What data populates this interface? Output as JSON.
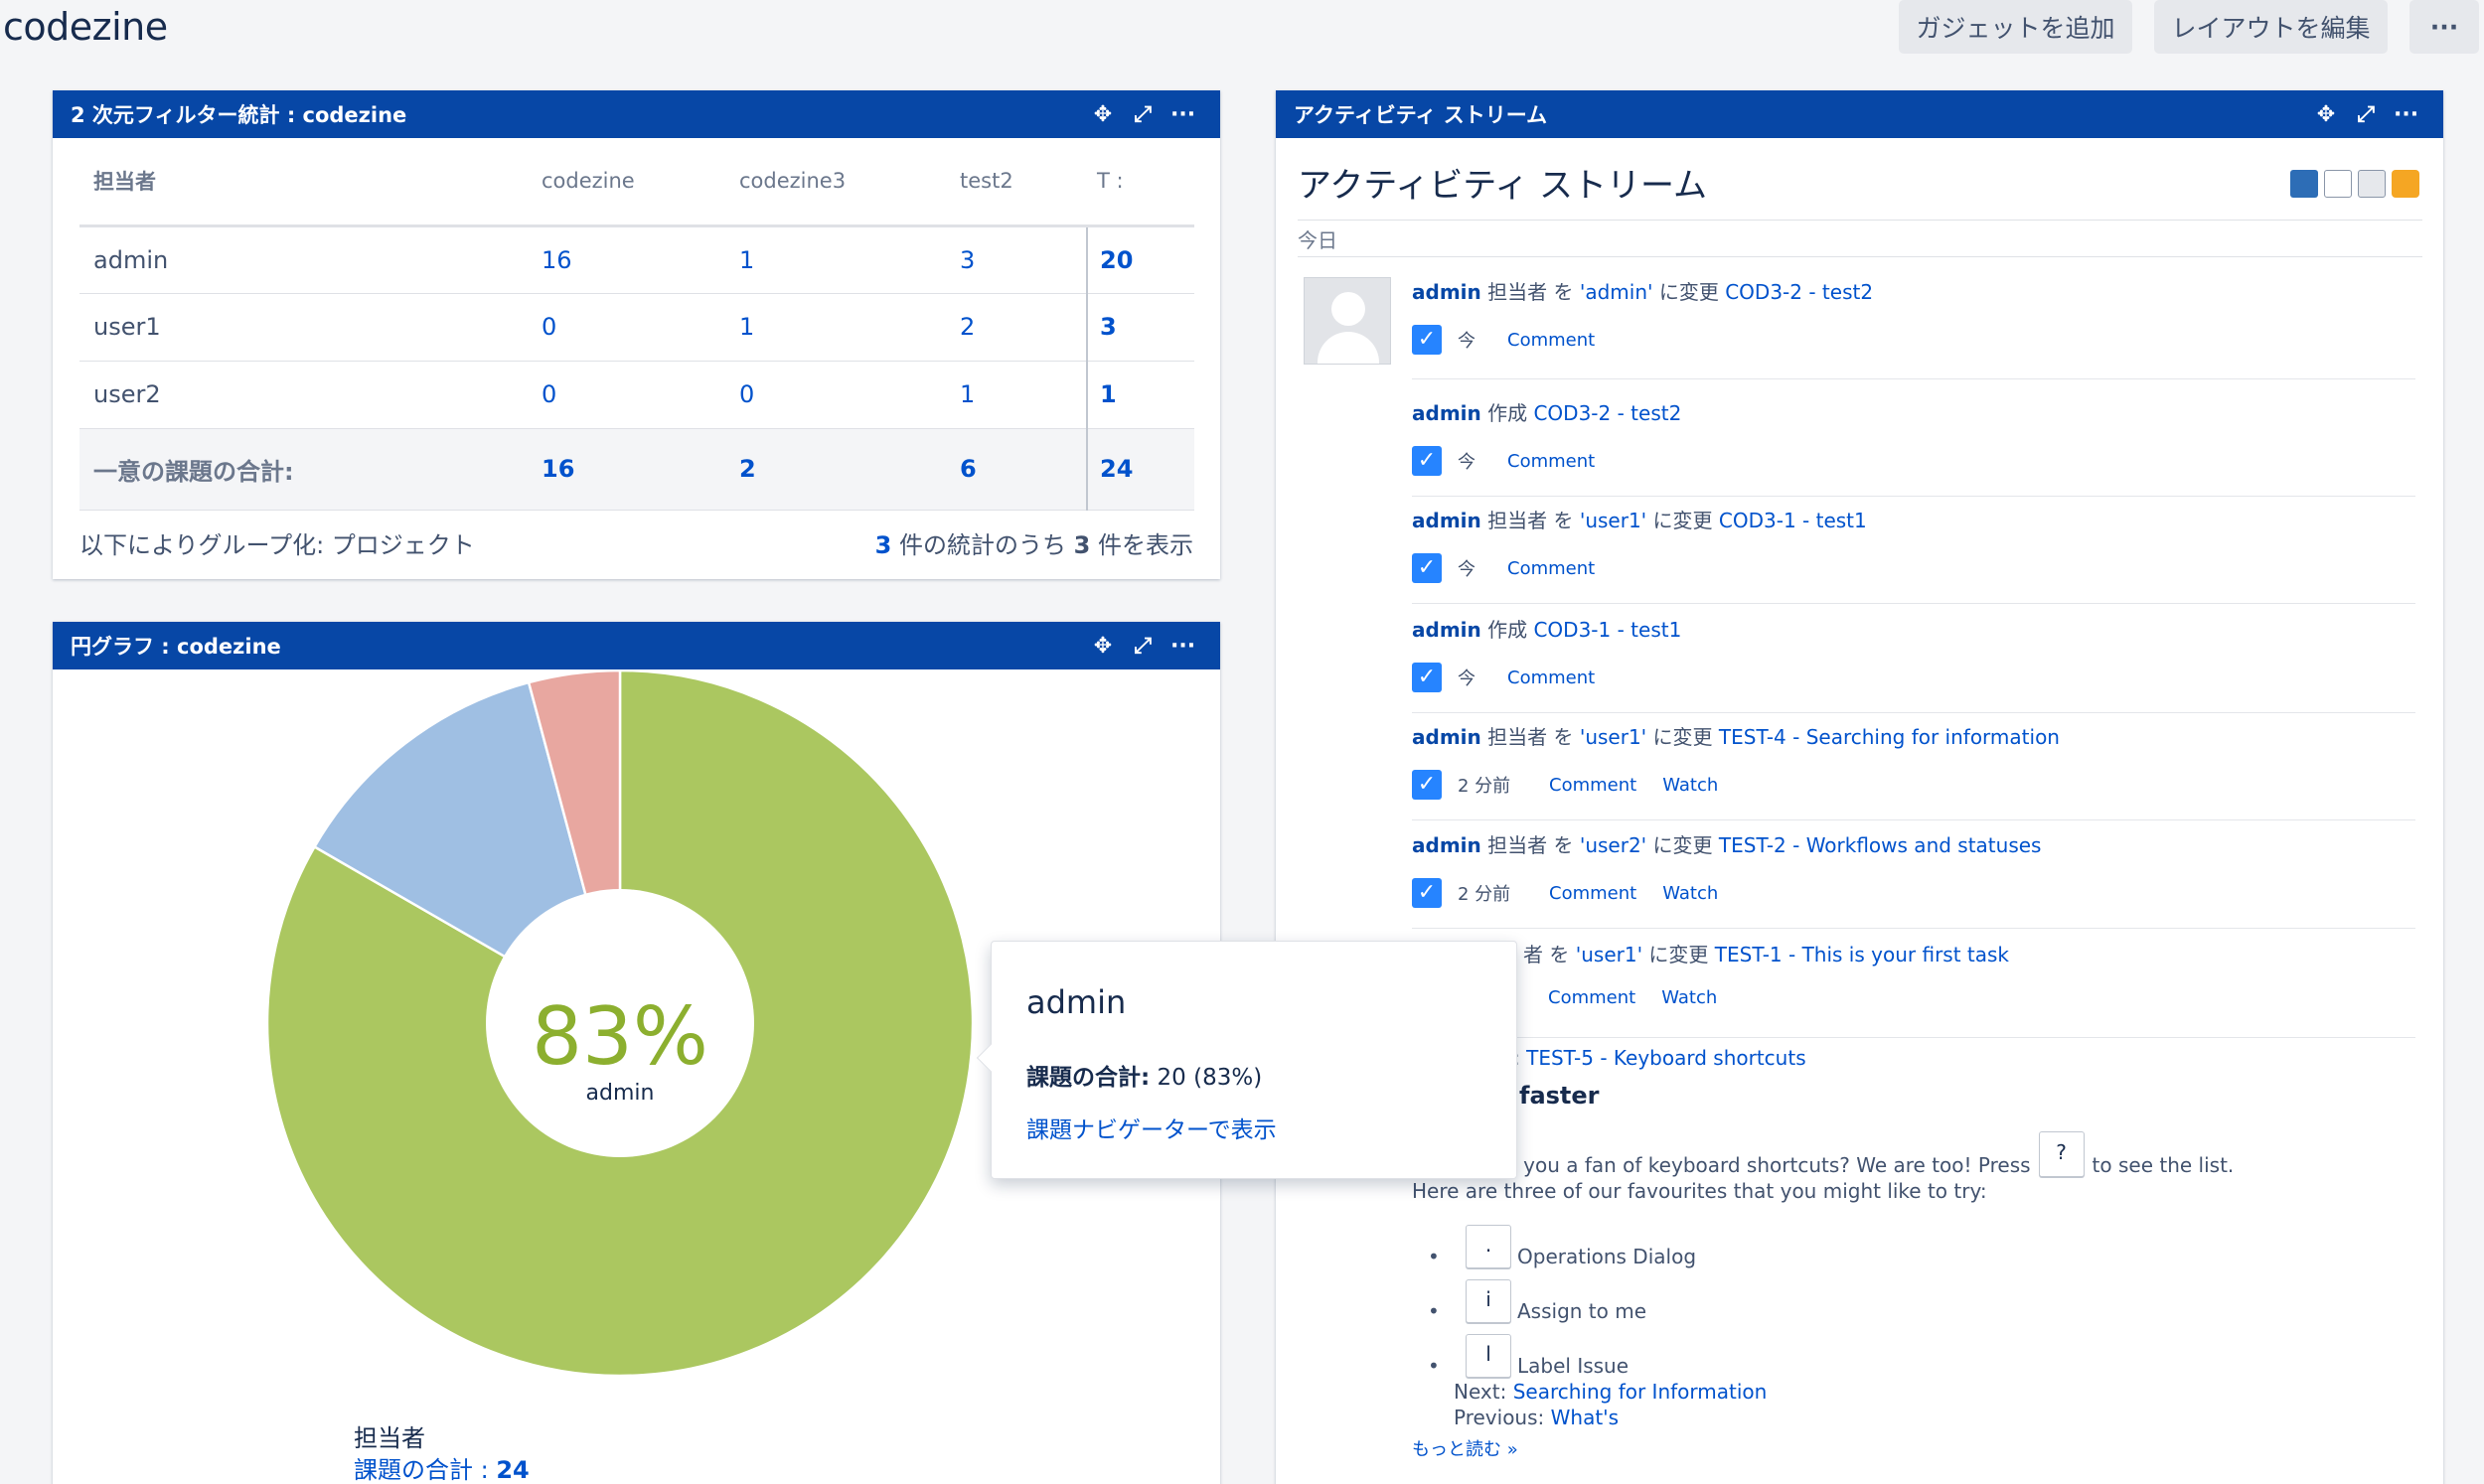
{
  "dashboard": {
    "title": "codezine",
    "add_gadget": "ガジェットを追加",
    "edit_layout": "レイアウトを編集",
    "more": "···"
  },
  "icons": {
    "move": "move-icon",
    "expand": "expand-icon",
    "menu": "more-icon"
  },
  "two_d": {
    "title": "2 次元フィルター統計 : codezine",
    "headers": [
      "担当者",
      "codezine",
      "codezine3",
      "test2",
      "T :"
    ],
    "rows": [
      {
        "name": "admin",
        "values": [
          "16",
          "1",
          "3"
        ],
        "total": "20"
      },
      {
        "name": "user1",
        "values": [
          "0",
          "1",
          "2"
        ],
        "total": "3"
      },
      {
        "name": "user2",
        "values": [
          "0",
          "0",
          "1"
        ],
        "total": "1"
      }
    ],
    "sum": {
      "label": "一意の課題の合計:",
      "values": [
        "16",
        "2",
        "6"
      ],
      "total": "24"
    },
    "group_by": "以下によりグループ化: プロジェクト",
    "count_shown": "3",
    "count_mid": "件の統計のうち",
    "count_total": "3",
    "count_end": "件を表示"
  },
  "pie": {
    "title": "円グラフ : codezine",
    "center_pct": "83%",
    "center_label": "admin",
    "legend_title": "担当者",
    "legend_total_label": "課題の合計 :",
    "legend_total": "24",
    "tooltip": {
      "name": "admin",
      "label": "課題の合計:",
      "value": "20 (83%)",
      "link": "課題ナビゲーターで表示"
    }
  },
  "chart_data": {
    "type": "pie",
    "categories": [
      "admin",
      "user1",
      "user2"
    ],
    "values": [
      20,
      3,
      1
    ],
    "colors": [
      "#abc760",
      "#9fbfe3",
      "#e8a7a0"
    ],
    "total": 24
  },
  "activity": {
    "header": "アクティビティ ストリーム",
    "title": "アクティビティ ストリーム",
    "today": "今日",
    "entries": [
      {
        "user": "admin",
        "verb": "担当者 を",
        "target": "'admin'",
        "verb2": "に変更",
        "issue": "COD3-2 - test2",
        "time": "今",
        "actions": [
          "Comment"
        ]
      },
      {
        "user": "admin",
        "verb": "作成",
        "target": "",
        "verb2": "",
        "issue": "COD3-2 - test2",
        "time": "今",
        "actions": [
          "Comment"
        ]
      },
      {
        "user": "admin",
        "verb": "担当者 を",
        "target": "'user1'",
        "verb2": "に変更",
        "issue": "COD3-1 - test1",
        "time": "今",
        "actions": [
          "Comment"
        ]
      },
      {
        "user": "admin",
        "verb": "作成",
        "target": "",
        "verb2": "",
        "issue": "COD3-1 - test1",
        "time": "今",
        "actions": [
          "Comment"
        ]
      },
      {
        "user": "admin",
        "verb": "担当者 を",
        "target": "'user1'",
        "verb2": "に変更",
        "issue": "TEST-4 - Searching for information",
        "time": "2 分前",
        "actions": [
          "Comment",
          "Watch"
        ]
      },
      {
        "user": "admin",
        "verb": "担当者 を",
        "target": "'user2'",
        "verb2": "に変更",
        "issue": "TEST-2 - Workflows and statuses",
        "time": "2 分前",
        "actions": [
          "Comment",
          "Watch"
        ]
      },
      {
        "user": "",
        "verb": "者 を",
        "target": "'user1'",
        "verb2": "に変更",
        "issue": "TEST-1 - This is your first task",
        "time": "",
        "actions": [
          "Comment",
          "Watch"
        ]
      }
    ],
    "last": {
      "issue_prefix": ":",
      "issue": "TEST-5 - Keyboard shortcuts",
      "heading": "faster",
      "p1_a": "Are you a fan of keyboard shortcuts? We are too! Press",
      "key_q": "?",
      "p1_b": "to see the list.",
      "p2": "Here are three of our favourites that you might like to try:",
      "shortcuts": [
        {
          "key": ".",
          "label": "Operations Dialog"
        },
        {
          "key": "i",
          "label": "Assign to me"
        },
        {
          "key": "l",
          "label": "Label Issue"
        }
      ],
      "next_label": "Next:",
      "next_link": "Searching for Information",
      "prev_label": "Previous:",
      "prev_link": "What's",
      "more": "もっと読む »"
    }
  }
}
